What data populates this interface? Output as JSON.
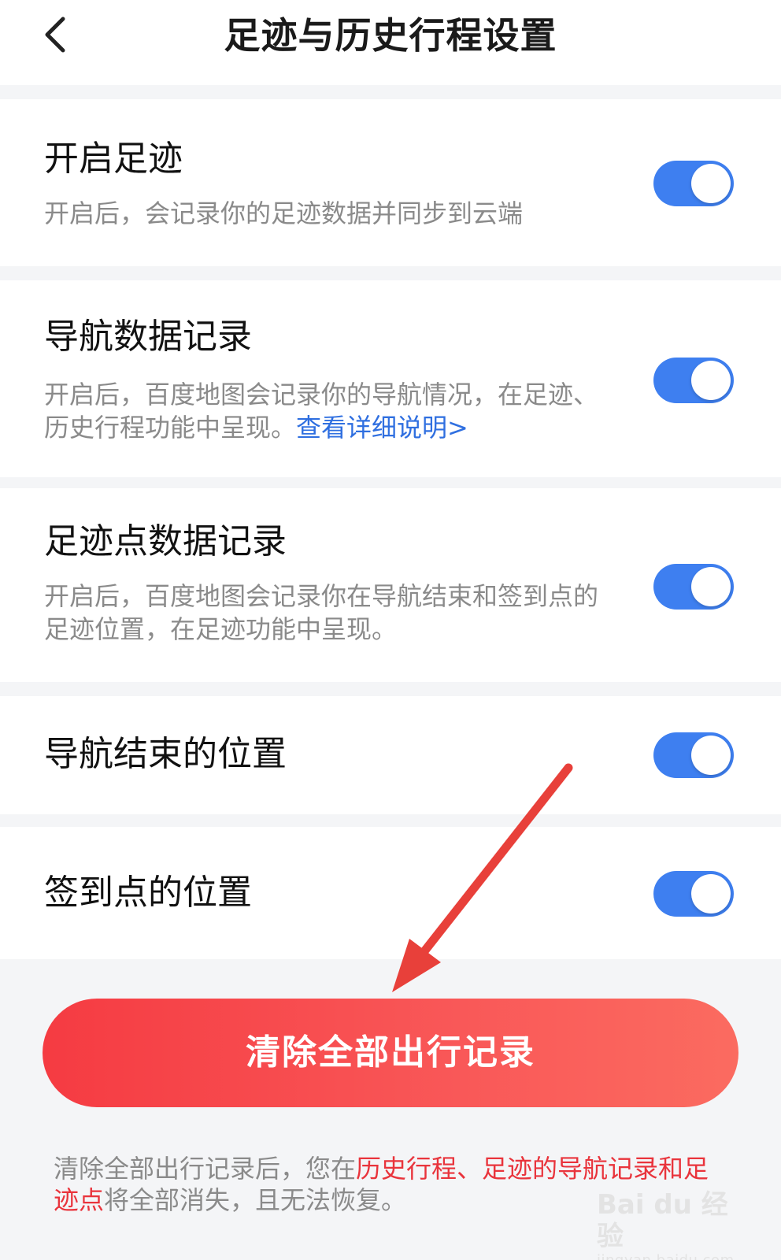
{
  "header": {
    "back_icon": "chevron-left-icon",
    "title": "足迹与历史行程设置"
  },
  "settings": [
    {
      "title": "开启足迹",
      "description": "开启后，会记录你的足迹数据并同步到云端",
      "enabled": true
    },
    {
      "title": "导航数据记录",
      "description": "开启后，百度地图会记录你的导航情况，在足迹、历史行程功能中呈现。",
      "link": "查看详细说明>",
      "enabled": true
    },
    {
      "title": "足迹点数据记录",
      "description": "开启后，百度地图会记录你在导航结束和签到点的足迹位置，在足迹功能中呈现。",
      "enabled": true
    },
    {
      "title": "导航结束的位置",
      "enabled": true
    },
    {
      "title": "签到点的位置",
      "enabled": true
    }
  ],
  "clear_button": {
    "label": "清除全部出行记录"
  },
  "footer": {
    "part1": "清除全部出行记录后，您在",
    "highlight": "历史行程、足迹的导航记录和足迹点",
    "part2": "将全部消失，且无法恢复。"
  },
  "watermark": {
    "main": "Bai du 经验",
    "sub": "jingyan.baidu.com"
  },
  "colors": {
    "toggle_on": "#3e7ff0",
    "link": "#2f6fe0",
    "danger": "#f53b42",
    "highlight_text": "#e9343c",
    "annotation_arrow": "#e8403a"
  }
}
